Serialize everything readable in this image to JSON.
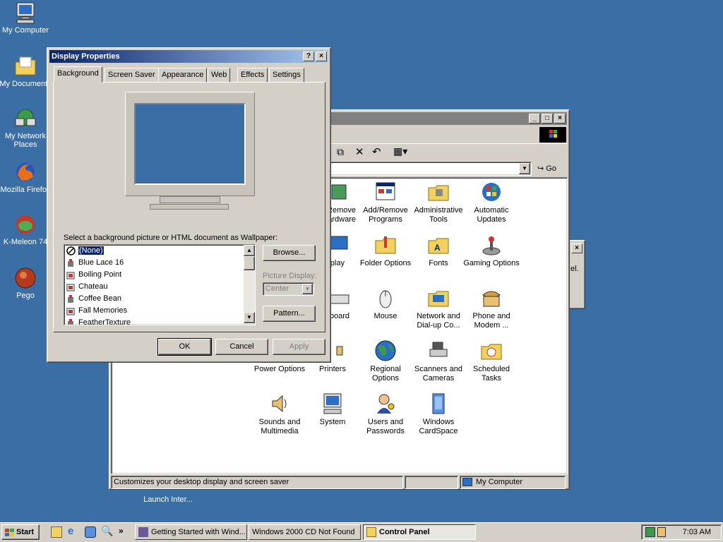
{
  "desktop": {
    "icons": [
      {
        "label": "My Computer",
        "icon": "computer-icon"
      },
      {
        "label": "My Documents",
        "icon": "folder-icon"
      },
      {
        "label": "My Network Places",
        "icon": "network-icon"
      },
      {
        "label": "Mozilla Firefox",
        "icon": "firefox-icon"
      },
      {
        "label": "K-Meleon 74",
        "icon": "kmeleon-icon"
      },
      {
        "label": "Pego",
        "icon": "pego-icon"
      }
    ],
    "launch_label": "Launch Inter..."
  },
  "control_panel": {
    "go_label": "Go",
    "items": [
      {
        "label": "Remove Hardware",
        "icon": "hardware-icon"
      },
      {
        "label": "Add/Remove Programs",
        "icon": "programs-icon"
      },
      {
        "label": "Administrative Tools",
        "icon": "admin-tools-icon"
      },
      {
        "label": "Automatic Updates",
        "icon": "updates-icon"
      },
      {
        "label": "Display",
        "icon": "display-icon"
      },
      {
        "label": "Folder Options",
        "icon": "folder-options-icon"
      },
      {
        "label": "Fonts",
        "icon": "fonts-icon"
      },
      {
        "label": "Gaming Options",
        "icon": "joystick-icon"
      },
      {
        "label": "Keyboard",
        "icon": "keyboard-icon"
      },
      {
        "label": "Mouse",
        "icon": "mouse-icon"
      },
      {
        "label": "Network and Dial-up Co...",
        "icon": "network-connections-icon"
      },
      {
        "label": "Phone and Modem ...",
        "icon": "phone-icon"
      },
      {
        "label": "Power Options",
        "icon": "power-icon"
      },
      {
        "label": "Printers",
        "icon": "printer-icon"
      },
      {
        "label": "Regional Options",
        "icon": "globe-icon"
      },
      {
        "label": "Scanners and Cameras",
        "icon": "scanner-icon"
      },
      {
        "label": "Scheduled Tasks",
        "icon": "scheduled-tasks-icon"
      },
      {
        "label": "Sounds and Multimedia",
        "icon": "speaker-icon"
      },
      {
        "label": "System",
        "icon": "system-icon"
      },
      {
        "label": "Users and Passwords",
        "icon": "users-icon"
      },
      {
        "label": "Windows CardSpace",
        "icon": "cardspace-icon"
      }
    ],
    "status_text": "Customizes your desktop display and screen saver",
    "status_zone": "My Computer"
  },
  "bg_dialog": {
    "text": "el."
  },
  "display_properties": {
    "title": "Display Properties",
    "help_btn": "?",
    "close_btn": "×",
    "tabs": [
      "Background",
      "Screen Saver",
      "Appearance",
      "Web",
      "Effects",
      "Settings"
    ],
    "active_tab": "Background",
    "wallpaper_prompt": "Select a background picture or HTML document as Wallpaper:",
    "wallpapers": [
      "(None)",
      "Blue Lace 16",
      "Boiling Point",
      "Chateau",
      "Coffee Bean",
      "Fall Memories",
      "FeatherTexture"
    ],
    "selected_wallpaper": "(None)",
    "browse_label": "Browse...",
    "picture_display_label": "Picture Display:",
    "picture_display_value": "Center",
    "pattern_label": "Pattern...",
    "ok_label": "OK",
    "cancel_label": "Cancel",
    "apply_label": "Apply"
  },
  "taskbar": {
    "start_label": "Start",
    "chevron": "»",
    "buttons": [
      {
        "label": "Getting Started with Wind..."
      },
      {
        "label": "Windows 2000 CD Not Found"
      },
      {
        "label": "Control Panel"
      }
    ],
    "clock": "7:03 AM"
  },
  "colors": {
    "desktop": "#3a6ea5",
    "title_active": "#0a246a",
    "title_inactive": "#808080",
    "face": "#d4d0c8",
    "selection": "#0a246a"
  }
}
